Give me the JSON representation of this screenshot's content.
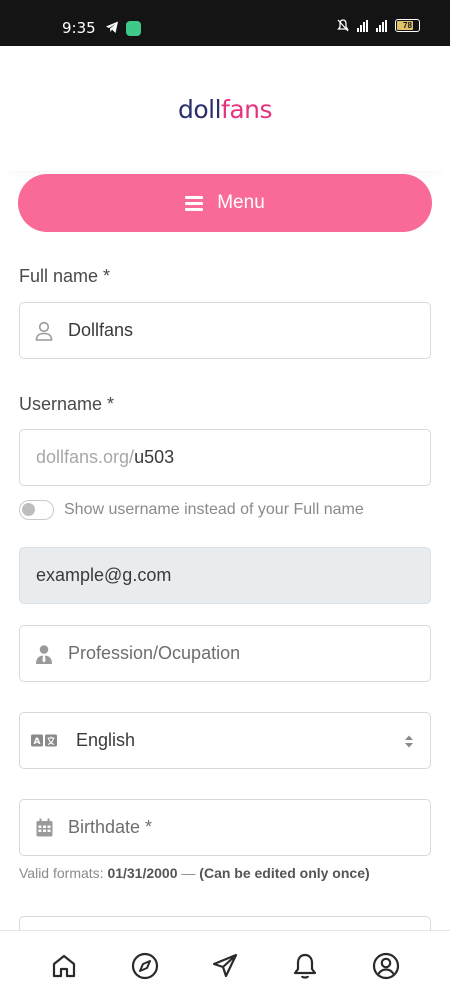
{
  "status_bar": {
    "time": "9:35",
    "battery": "78",
    "icons": [
      "telegram-icon",
      "phone-app-icon",
      "mute-icon",
      "network-icon",
      "signal-icon",
      "battery-icon"
    ]
  },
  "header": {
    "logo_part1": "doll",
    "logo_part2": "fans"
  },
  "menu": {
    "label": "Menu"
  },
  "form": {
    "full_name_label": "Full name *",
    "full_name_value": "Dollfans",
    "username_label": "Username *",
    "username_prefix": "dollfans.org/",
    "username_value": "u503",
    "toggle_label": "Show username instead of your Full name",
    "email_value": "example@g.com",
    "profession_placeholder": "Profession/Ocupation",
    "language_value": "English",
    "birthdate_placeholder": "Birthdate *",
    "help_prefix": "Valid formats: ",
    "help_format": "01/31/2000",
    "help_dash": " — ",
    "help_note": "(Can be edited only once)"
  },
  "bottom_nav": {
    "items": [
      "home-icon",
      "compass-icon",
      "send-icon",
      "bell-icon",
      "account-icon"
    ]
  },
  "colors": {
    "accent": "#f96b96",
    "logo_dark": "#2b2f6b",
    "logo_pink": "#e6337e"
  }
}
